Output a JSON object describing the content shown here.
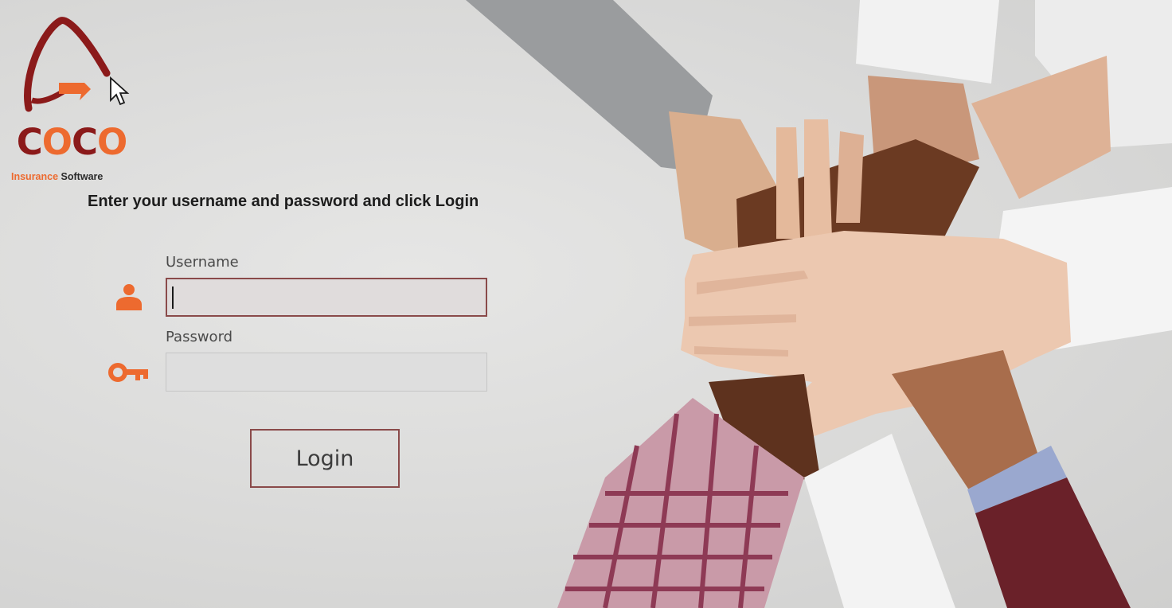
{
  "logo": {
    "word_dark": "C",
    "word_orange_1": "O",
    "word_dark_2": "C",
    "word_orange_2": "O",
    "subtitle_orange": "Insurance",
    "subtitle_dark": "Software",
    "brand_dark": "#8b1a1a",
    "brand_orange": "#ed6a2f"
  },
  "instruction": "Enter your username and password and click Login",
  "username": {
    "label": "Username",
    "value": "",
    "icon": "user-icon"
  },
  "password": {
    "label": "Password",
    "value": "",
    "icon": "key-icon"
  },
  "login_button": "Login",
  "colors": {
    "accent": "#ed6a2f",
    "border_focus": "#8a4a4a",
    "background": "#dcdcdb"
  }
}
